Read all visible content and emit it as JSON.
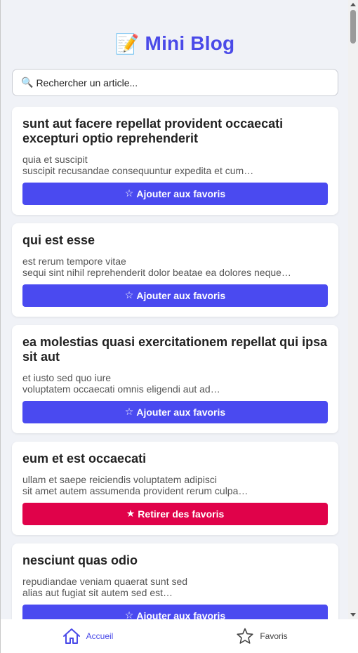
{
  "header": {
    "emoji": "📝",
    "title": "Mini Blog"
  },
  "search": {
    "icon": "🔍",
    "placeholder": "Rechercher un article..."
  },
  "posts": [
    {
      "title": "sunt aut facere repellat provident occaecati excepturi optio reprehenderit",
      "line1": "quia et suscipit",
      "line2": "suscipit recusandae consequuntur expedita et cum…",
      "button_icon": "☆",
      "button_label": "Ajouter aux favoris"
    },
    {
      "title": "qui est esse",
      "line1": "est rerum tempore vitae",
      "line2": "sequi sint nihil reprehenderit dolor beatae ea dolores neque…",
      "button_icon": "☆",
      "button_label": "Ajouter aux favoris"
    },
    {
      "title": "ea molestias quasi exercitationem repellat qui ipsa sit aut",
      "line1": "et iusto sed quo iure",
      "line2": "voluptatem occaecati omnis eligendi aut ad…",
      "button_icon": "☆",
      "button_label": "Ajouter aux favoris"
    },
    {
      "title": "eum et est occaecati",
      "line1": "ullam et saepe reiciendis voluptatem adipisci",
      "line2": "sit amet autem assumenda provident rerum culpa…",
      "button_icon": "★",
      "button_label": "Retirer des favoris"
    },
    {
      "title": "nesciunt quas odio",
      "line1": "repudiandae veniam quaerat sunt sed",
      "line2": "alias aut fugiat sit autem sed est…",
      "button_icon": "☆",
      "button_label": "Ajouter aux favoris"
    }
  ],
  "nav": {
    "home_label": "Accueil",
    "favorites_label": "Favoris"
  },
  "colors": {
    "accent": "#4a4af0",
    "remove": "#e0024a",
    "background": "#f0f2f7"
  }
}
